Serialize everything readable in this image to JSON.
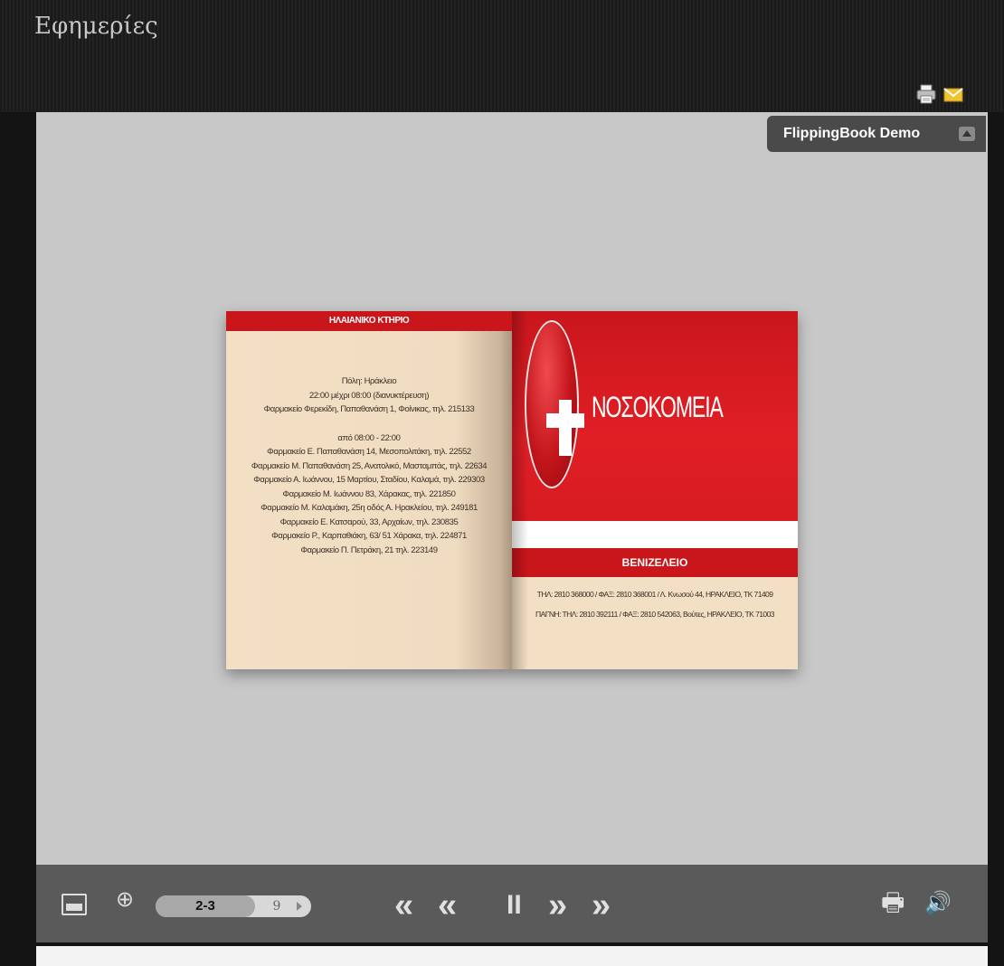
{
  "header": {
    "title": "Εφημερίες",
    "icons": [
      "print-icon",
      "email-icon"
    ]
  },
  "viewer": {
    "demo_tab_label": "FlippingBook Demo",
    "book": {
      "left_page": {
        "header_band": "ΗΛΑΙΑΝΙΚΟ ΚΤΗΡΙΟ",
        "lines": [
          "Πόλη: Ηράκλειο",
          "22:00 μέχρι 08:00 (διανυκτέρευση)",
          "Φαρμακείο Φερεκίδη, Παπαθανάση 1, Φοίνικας, τηλ. 215133",
          "",
          "από 08:00 - 22:00",
          "Φαρμακείο Ε. Παπαθανάση 14, Μεσοπολιτάκη, τηλ. 22552",
          "Φαρμακείο Μ. Παπαθανάση 25, Ανατολικό, Μασταμπάς, τηλ. 22634",
          "Φαρμακείο Α. Ιωάννου, 15 Μαρτίου, Σταδίου, Καλαμά, τηλ. 229303",
          "Φαρμακείο Μ. Ιωάννου 83, Χάρακας, τηλ. 221850",
          "Φαρμακείο Μ. Καλαμάκη, 25η οδός Α. Ηρακλείου, τηλ. 249181",
          "Φαρμακείο Ε. Κατσαρού, 33, Αρχαίων, τηλ. 230835",
          "Φαρμακείο Ρ., Καρπαθιάκη, 63/ 51 Χάρακα, τηλ. 224871",
          "Φαρμακείο Π. Πετράκη, 21 τηλ. 223149"
        ]
      },
      "right_page": {
        "title": "ΝΟΣΟΚΟΜΕΙΑ",
        "band2_label": "ΒΕΝΙΖΕΛΕΙΟ",
        "lines": [
          "ΤΗΛ: 2810 368000 / ΦΑΞ: 2810 368001 / Λ. Κνωσού 44, ΗΡΑΚΛΕΙΟ, ΤΚ 71409",
          "ΠΑΓΝΗ: ΤΗΛ: 2810 392111 / ΦΑΞ: 2810 542063, Βούτες, ΗΡΑΚΛΕΙΟ, ΤΚ 71003"
        ]
      }
    }
  },
  "toolbar": {
    "page_current": "2-3",
    "page_total": "9",
    "nav": {
      "first": "«",
      "prev": "‹‹",
      "pause": "II",
      "next": "»",
      "last": "»"
    },
    "print_glyph": "🖶",
    "sound_glyph": "🔊",
    "zoom_glyph": "⊕"
  }
}
